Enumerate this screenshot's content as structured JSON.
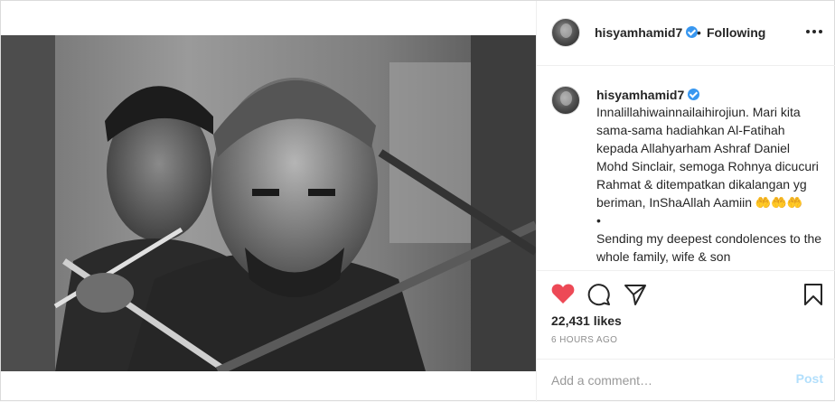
{
  "post": {
    "photo_description": "black-and-white still of two men holding swords",
    "author": {
      "username": "hisyamhamid7",
      "verified": true
    },
    "header": {
      "separator": "•",
      "follow_status": "Following",
      "more_icon": "more-horizontal-icon"
    },
    "caption": {
      "username": "hisyamhamid7",
      "text": "Innalillahiwainnailaihirojiun. Mari kita sama-sama hadiahkan Al-Fatihah kepada Allahyarham Ashraf Daniel Mohd Sinclair, semoga Rohnya dicucuri Rahmat & ditempatkan dikalangan yg beriman, InShaAllah Aamiin 🤲🤲🤲\n•\nSending my deepest condolences to the whole family, wife & son"
    },
    "actions": {
      "like_icon": "heart-filled-icon",
      "comment_icon": "comment-icon",
      "share_icon": "paper-plane-icon",
      "save_icon": "bookmark-icon",
      "liked": true,
      "like_color": "#ed4956"
    },
    "likes": "22,431 likes",
    "timestamp": "6 HOURS AGO",
    "comment_box": {
      "placeholder": "Add a comment…",
      "post_label": "Post"
    }
  }
}
